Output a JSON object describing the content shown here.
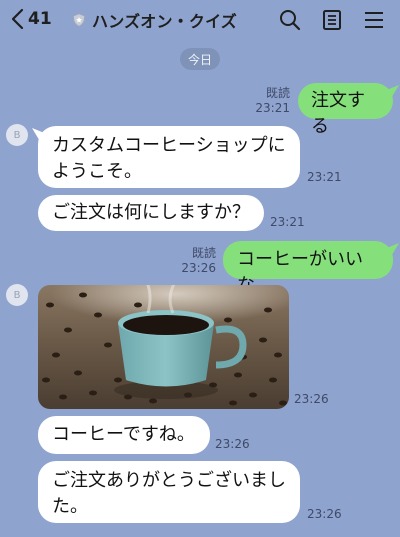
{
  "header": {
    "back_count": "41",
    "title": "ハンズオン・クイズ",
    "icons": [
      "back-chevron-icon",
      "shield-icon",
      "search-icon",
      "notes-icon",
      "menu-icon"
    ]
  },
  "date_divider": "今日",
  "avatar_label": "B",
  "messages": {
    "m1": {
      "text": "注文する",
      "read": "既読",
      "time": "23:21"
    },
    "m2": {
      "text": "カスタムコーヒーショップにようこそ。",
      "time": "23:21"
    },
    "m3": {
      "text": "ご注文は何にしますか？",
      "time": "23:21"
    },
    "m4": {
      "text": "コーヒーがいいな",
      "read": "既読",
      "time": "23:26"
    },
    "m5": {
      "image": "coffee-cup-photo",
      "time": "23:26"
    },
    "m6": {
      "text": "コーヒーですね。",
      "time": "23:26"
    },
    "m7": {
      "text": "ご注文ありがとうございました。",
      "time": "23:26"
    }
  },
  "colors": {
    "background": "#8fa3cf",
    "outgoing_bubble": "#85e07b",
    "incoming_bubble": "#ffffff"
  }
}
